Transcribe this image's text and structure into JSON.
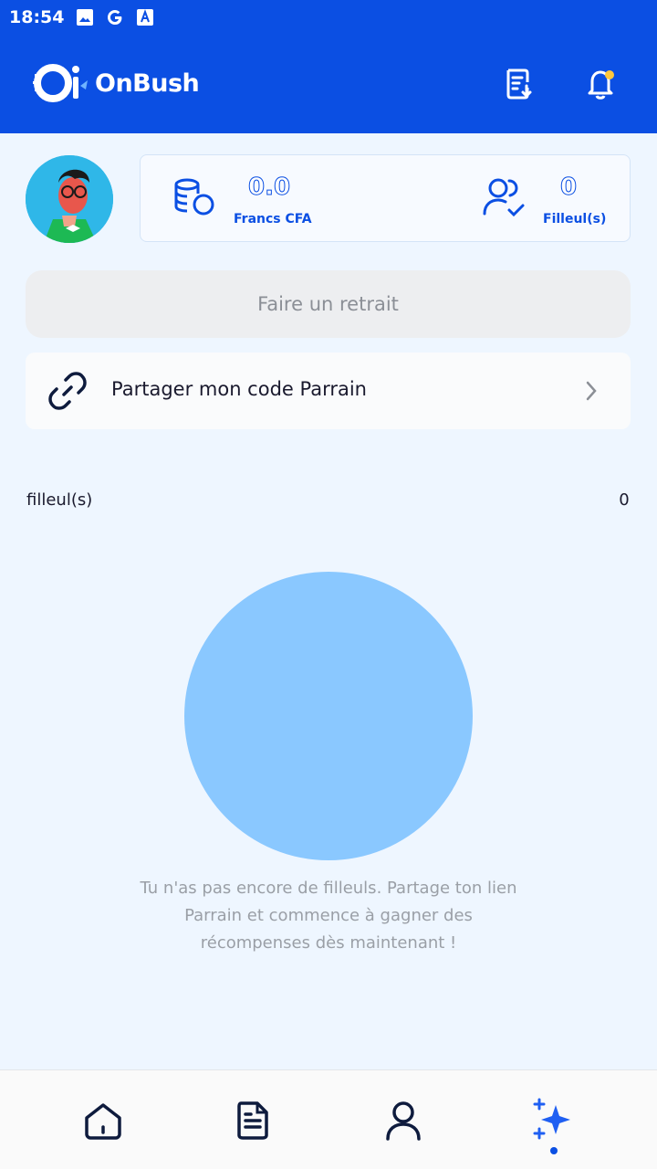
{
  "status_bar": {
    "time": "18:54",
    "icons": [
      "image-icon",
      "google-icon",
      "font-icon"
    ]
  },
  "header": {
    "logo_text": "OnBush",
    "icons": [
      "document-download-icon",
      "bell-icon"
    ],
    "colors": {
      "brand": "#0B4FE3",
      "notification_dot": "#FFC83D"
    }
  },
  "stats": {
    "balance_value": "0.0",
    "balance_label": "Francs CFA",
    "referrals_value": "0",
    "referrals_label": "Filleul(s)"
  },
  "actions": {
    "withdraw_label": "Faire un retrait",
    "share_label": "Partager mon code Parrain"
  },
  "referrals_section": {
    "title": "filleul(s)",
    "count": "0",
    "empty_message": "Tu n'as pas encore de filleuls. Partage ton lien Parrain et commence à gagner des récompenses dès maintenant !"
  },
  "bottom_nav": {
    "items": [
      {
        "icon": "home-icon"
      },
      {
        "icon": "document-icon"
      },
      {
        "icon": "user-icon"
      },
      {
        "icon": "sparkles-icon",
        "active": true
      }
    ]
  }
}
